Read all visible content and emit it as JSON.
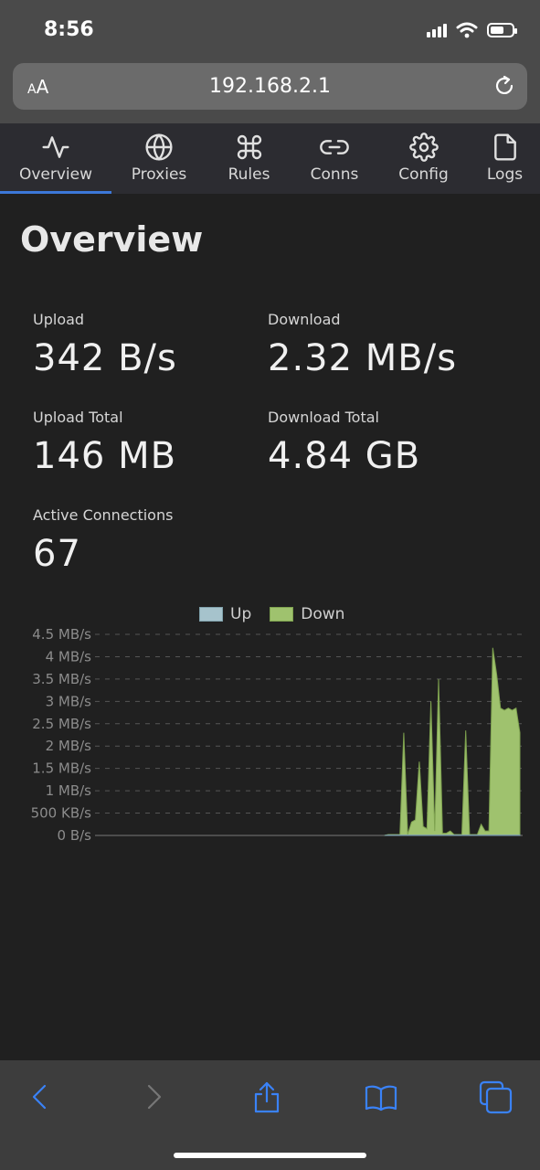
{
  "status": {
    "time": "8:56"
  },
  "browser": {
    "url": "192.168.2.1",
    "text_size_small": "A",
    "text_size_large": "A"
  },
  "tabs": [
    {
      "label": "Overview",
      "icon": "activity-icon",
      "active": true
    },
    {
      "label": "Proxies",
      "icon": "globe-icon"
    },
    {
      "label": "Rules",
      "icon": "command-icon"
    },
    {
      "label": "Conns",
      "icon": "link-icon"
    },
    {
      "label": "Config",
      "icon": "gear-icon"
    },
    {
      "label": "Logs",
      "icon": "file-icon"
    }
  ],
  "page": {
    "title": "Overview"
  },
  "stats": {
    "upload": {
      "label": "Upload",
      "value": "342 B/s"
    },
    "download": {
      "label": "Download",
      "value": "2.32 MB/s"
    },
    "upload_total": {
      "label": "Upload Total",
      "value": "146 MB"
    },
    "download_total": {
      "label": "Download Total",
      "value": "4.84 GB"
    },
    "active_connections": {
      "label": "Active Connections",
      "value": "67"
    }
  },
  "colors": {
    "accent": "#3c78d8",
    "up": "#a6c3cc",
    "down": "#9fc26e",
    "toolbar_icon": "#3a82f7"
  },
  "chart_data": {
    "type": "area",
    "legend": [
      "Up",
      "Down"
    ],
    "y_ticks": [
      "0 B/s",
      "500 KB/s",
      "1 MB/s",
      "1.5 MB/s",
      "2 MB/s",
      "2.5 MB/s",
      "3 MB/s",
      "3.5 MB/s",
      "4 MB/s",
      "4.5 MB/s"
    ],
    "ylim": [
      0,
      4.5
    ],
    "yunit": "MB/s",
    "grid": true,
    "series": [
      {
        "name": "Down",
        "values": [
          0,
          0,
          0,
          0,
          0,
          0,
          0,
          0,
          0,
          0,
          0,
          0,
          0,
          0,
          0,
          0,
          0,
          0,
          0,
          0,
          0,
          0,
          0,
          0,
          0,
          0,
          0,
          0,
          0,
          0,
          0,
          0,
          0,
          0,
          0,
          0,
          0,
          0,
          0,
          0,
          0,
          0,
          0,
          0,
          0,
          0,
          0,
          0,
          0,
          0,
          0,
          0,
          0,
          0,
          0,
          0,
          0,
          0,
          0,
          0,
          0,
          0,
          0,
          0,
          0,
          0,
          0,
          0,
          0,
          0,
          0,
          0,
          0.02,
          0.02,
          0.02,
          0.02,
          2.3,
          0.02,
          0.3,
          0.35,
          1.65,
          0.2,
          0.15,
          3.0,
          0.1,
          3.5,
          0.05,
          0.05,
          0.1,
          0.02,
          0.02,
          0.02,
          2.35,
          0.02,
          0.02,
          0.02,
          0.25,
          0.1,
          0.1,
          4.2,
          3.6,
          2.85,
          2.8,
          2.85,
          2.8,
          2.85,
          2.3
        ]
      },
      {
        "name": "Up",
        "values": [
          0,
          0,
          0,
          0,
          0,
          0,
          0,
          0,
          0,
          0,
          0,
          0,
          0,
          0,
          0,
          0,
          0,
          0,
          0,
          0,
          0,
          0,
          0,
          0,
          0,
          0,
          0,
          0,
          0,
          0,
          0,
          0,
          0,
          0,
          0,
          0,
          0,
          0,
          0,
          0,
          0,
          0,
          0,
          0,
          0,
          0,
          0,
          0,
          0,
          0,
          0,
          0,
          0,
          0,
          0,
          0,
          0,
          0,
          0,
          0,
          0,
          0,
          0,
          0,
          0,
          0,
          0,
          0,
          0,
          0,
          0,
          0,
          0.01,
          0.01,
          0.01,
          0.01,
          0.01,
          0.01,
          0.01,
          0.01,
          0.01,
          0.01,
          0.01,
          0.01,
          0.01,
          0.01,
          0.01,
          0.01,
          0.01,
          0.01,
          0.01,
          0.01,
          0.01,
          0.01,
          0.01,
          0.01,
          0.01,
          0.01,
          0.01,
          0.01,
          0.01,
          0.01,
          0.01,
          0.01,
          0.01,
          0.01,
          0.01
        ]
      }
    ]
  },
  "toolbar": {
    "buttons": [
      {
        "icon": "back-icon"
      },
      {
        "icon": "forward-icon"
      },
      {
        "icon": "share-icon"
      },
      {
        "icon": "bookmarks-icon"
      },
      {
        "icon": "tabs-icon"
      }
    ]
  }
}
